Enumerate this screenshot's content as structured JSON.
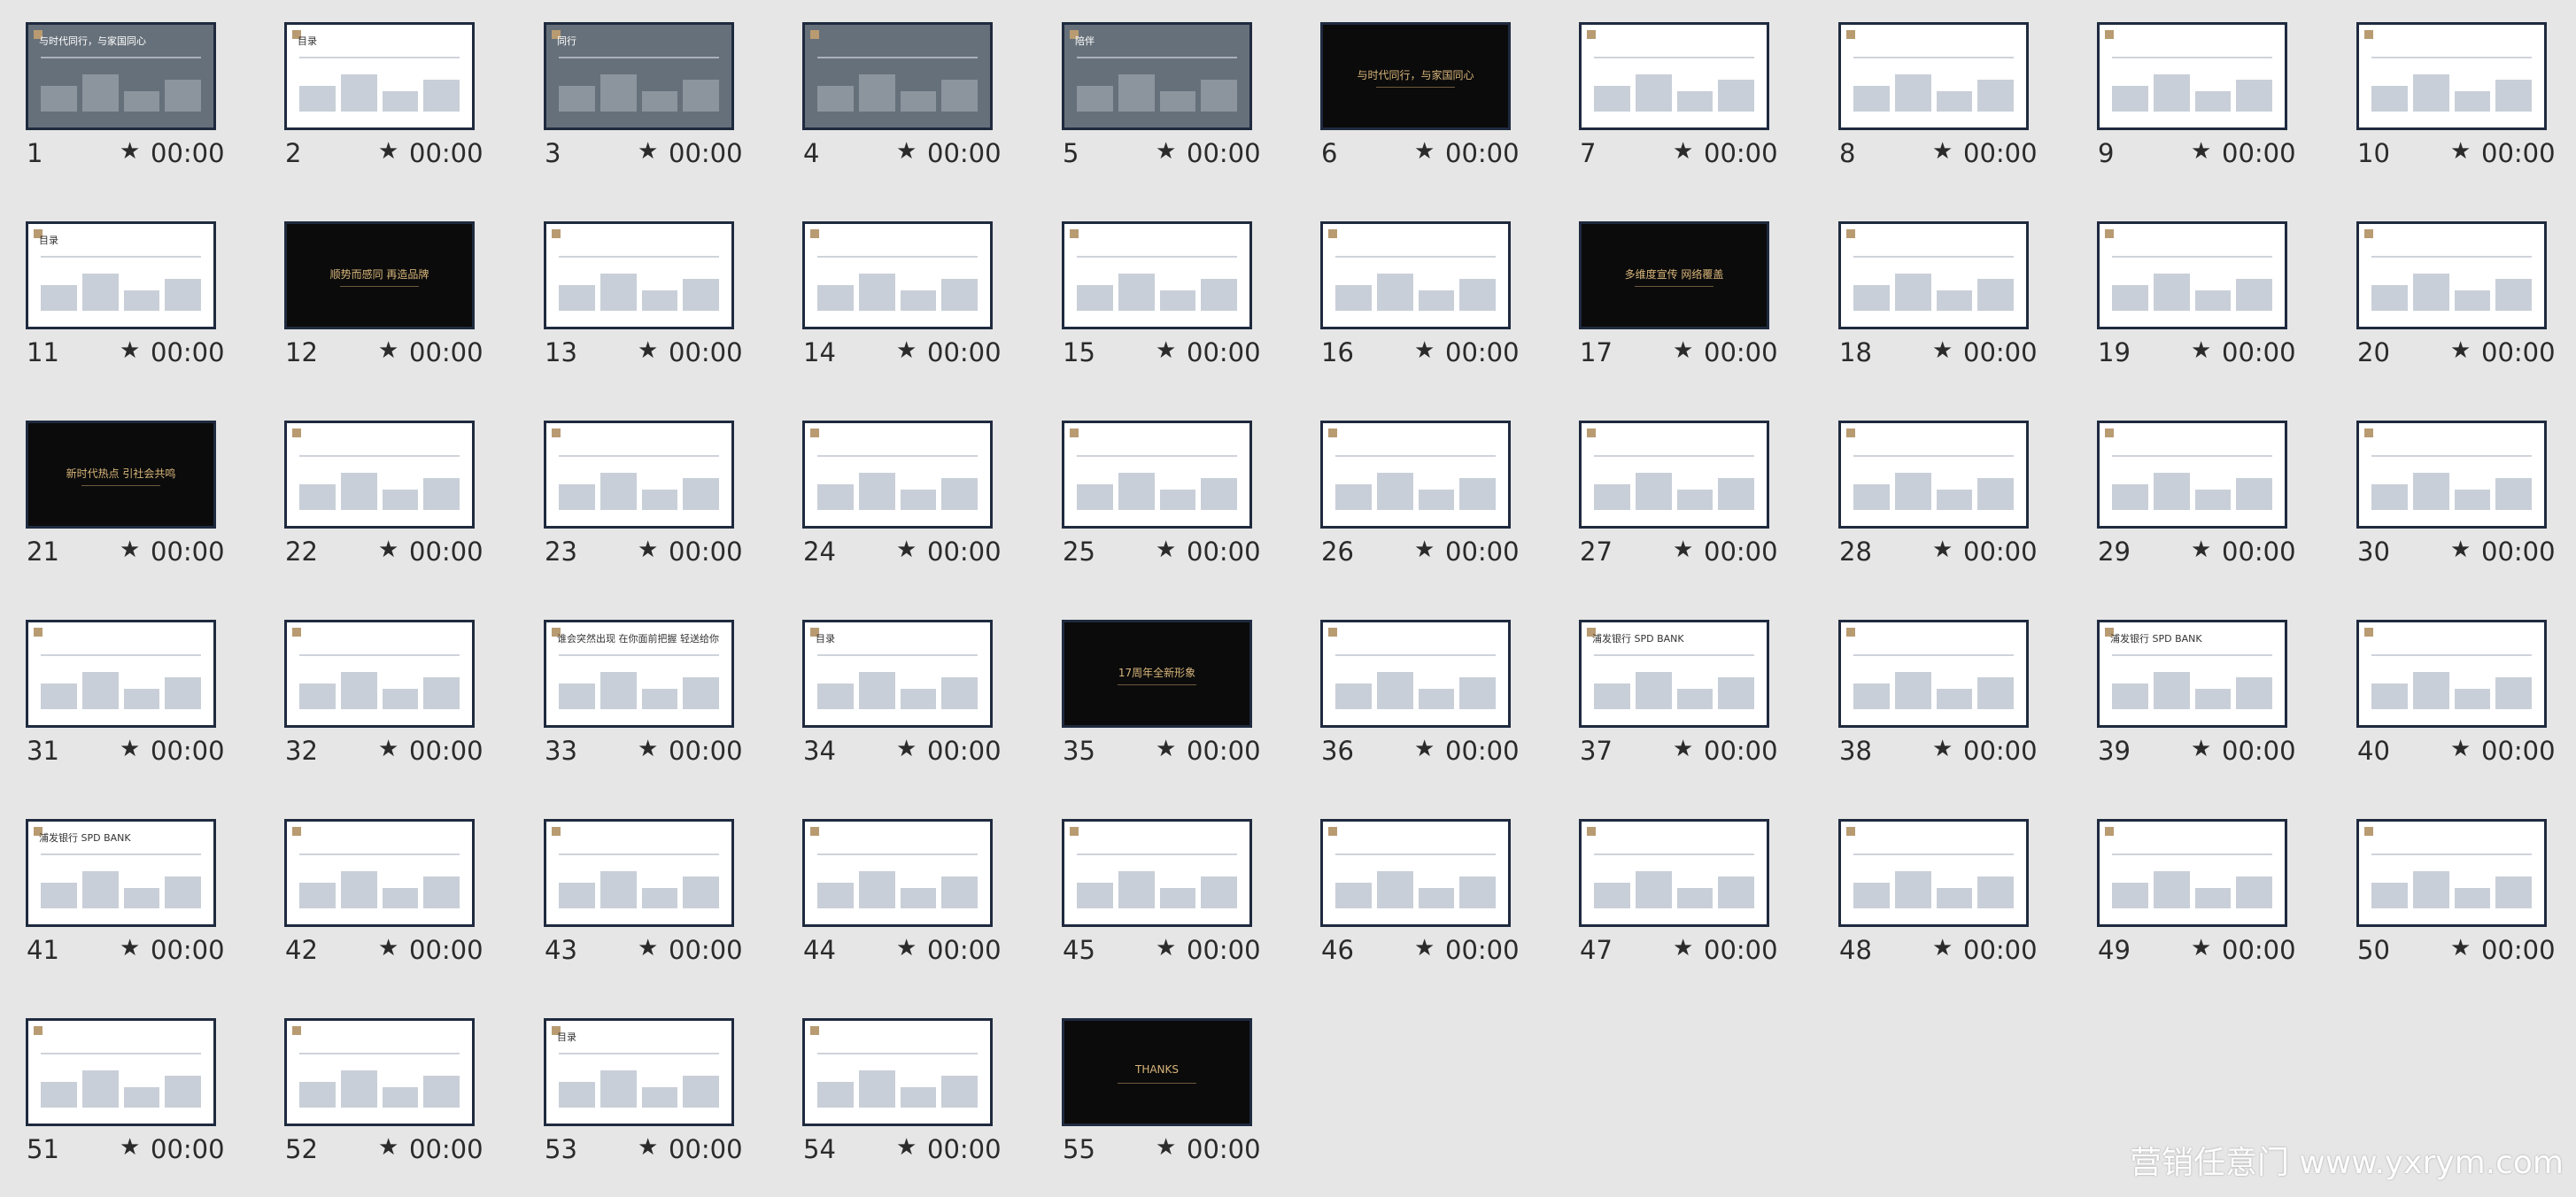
{
  "slides": [
    {
      "n": "1",
      "t": "00:00",
      "style": "photo",
      "title": "与时代同行，与家国同心"
    },
    {
      "n": "2",
      "t": "00:00",
      "style": "white",
      "title": "目录"
    },
    {
      "n": "3",
      "t": "00:00",
      "style": "photo",
      "title": "同行"
    },
    {
      "n": "4",
      "t": "00:00",
      "style": "photo",
      "title": ""
    },
    {
      "n": "5",
      "t": "00:00",
      "style": "photo",
      "title": "陪伴"
    },
    {
      "n": "6",
      "t": "00:00",
      "style": "dark",
      "title": "与时代同行，与家国同心"
    },
    {
      "n": "7",
      "t": "00:00",
      "style": "white",
      "title": ""
    },
    {
      "n": "8",
      "t": "00:00",
      "style": "white",
      "title": ""
    },
    {
      "n": "9",
      "t": "00:00",
      "style": "white",
      "title": ""
    },
    {
      "n": "10",
      "t": "00:00",
      "style": "white",
      "title": ""
    },
    {
      "n": "11",
      "t": "00:00",
      "style": "white",
      "title": "目录"
    },
    {
      "n": "12",
      "t": "00:00",
      "style": "dark",
      "title": "顺势而感同 再造品牌"
    },
    {
      "n": "13",
      "t": "00:00",
      "style": "white",
      "title": ""
    },
    {
      "n": "14",
      "t": "00:00",
      "style": "white",
      "title": ""
    },
    {
      "n": "15",
      "t": "00:00",
      "style": "white",
      "title": ""
    },
    {
      "n": "16",
      "t": "00:00",
      "style": "white",
      "title": ""
    },
    {
      "n": "17",
      "t": "00:00",
      "style": "dark",
      "title": "多维度宣传 网络覆盖"
    },
    {
      "n": "18",
      "t": "00:00",
      "style": "white",
      "title": ""
    },
    {
      "n": "19",
      "t": "00:00",
      "style": "white",
      "title": ""
    },
    {
      "n": "20",
      "t": "00:00",
      "style": "white",
      "title": ""
    },
    {
      "n": "21",
      "t": "00:00",
      "style": "dark",
      "title": "新时代热点 引社会共鸣"
    },
    {
      "n": "22",
      "t": "00:00",
      "style": "white",
      "title": ""
    },
    {
      "n": "23",
      "t": "00:00",
      "style": "white",
      "title": ""
    },
    {
      "n": "24",
      "t": "00:00",
      "style": "white",
      "title": ""
    },
    {
      "n": "25",
      "t": "00:00",
      "style": "white",
      "title": ""
    },
    {
      "n": "26",
      "t": "00:00",
      "style": "white",
      "title": ""
    },
    {
      "n": "27",
      "t": "00:00",
      "style": "white",
      "title": ""
    },
    {
      "n": "28",
      "t": "00:00",
      "style": "white",
      "title": ""
    },
    {
      "n": "29",
      "t": "00:00",
      "style": "white",
      "title": ""
    },
    {
      "n": "30",
      "t": "00:00",
      "style": "white",
      "title": ""
    },
    {
      "n": "31",
      "t": "00:00",
      "style": "white",
      "title": ""
    },
    {
      "n": "32",
      "t": "00:00",
      "style": "white",
      "title": ""
    },
    {
      "n": "33",
      "t": "00:00",
      "style": "white",
      "title": "谁会突然出现 在你面前把握 轻送给你"
    },
    {
      "n": "34",
      "t": "00:00",
      "style": "white",
      "title": "目录"
    },
    {
      "n": "35",
      "t": "00:00",
      "style": "dark",
      "title": "17周年全新形象"
    },
    {
      "n": "36",
      "t": "00:00",
      "style": "white",
      "title": ""
    },
    {
      "n": "37",
      "t": "00:00",
      "style": "white",
      "title": "浦发银行 SPD BANK"
    },
    {
      "n": "38",
      "t": "00:00",
      "style": "white",
      "title": ""
    },
    {
      "n": "39",
      "t": "00:00",
      "style": "white",
      "title": "浦发银行 SPD BANK"
    },
    {
      "n": "40",
      "t": "00:00",
      "style": "white",
      "title": ""
    },
    {
      "n": "41",
      "t": "00:00",
      "style": "white",
      "title": "浦发银行 SPD BANK"
    },
    {
      "n": "42",
      "t": "00:00",
      "style": "white",
      "title": ""
    },
    {
      "n": "43",
      "t": "00:00",
      "style": "white",
      "title": ""
    },
    {
      "n": "44",
      "t": "00:00",
      "style": "white",
      "title": ""
    },
    {
      "n": "45",
      "t": "00:00",
      "style": "white",
      "title": ""
    },
    {
      "n": "46",
      "t": "00:00",
      "style": "white",
      "title": ""
    },
    {
      "n": "47",
      "t": "00:00",
      "style": "white",
      "title": ""
    },
    {
      "n": "48",
      "t": "00:00",
      "style": "white",
      "title": ""
    },
    {
      "n": "49",
      "t": "00:00",
      "style": "white",
      "title": ""
    },
    {
      "n": "50",
      "t": "00:00",
      "style": "white",
      "title": ""
    },
    {
      "n": "51",
      "t": "00:00",
      "style": "white",
      "title": ""
    },
    {
      "n": "52",
      "t": "00:00",
      "style": "white",
      "title": ""
    },
    {
      "n": "53",
      "t": "00:00",
      "style": "white",
      "title": "目录"
    },
    {
      "n": "54",
      "t": "00:00",
      "style": "white",
      "title": ""
    },
    {
      "n": "55",
      "t": "00:00",
      "style": "dark",
      "title": "THANKS"
    }
  ],
  "star_glyph": "★",
  "watermark": "营销任意门 www.yxrym.com"
}
